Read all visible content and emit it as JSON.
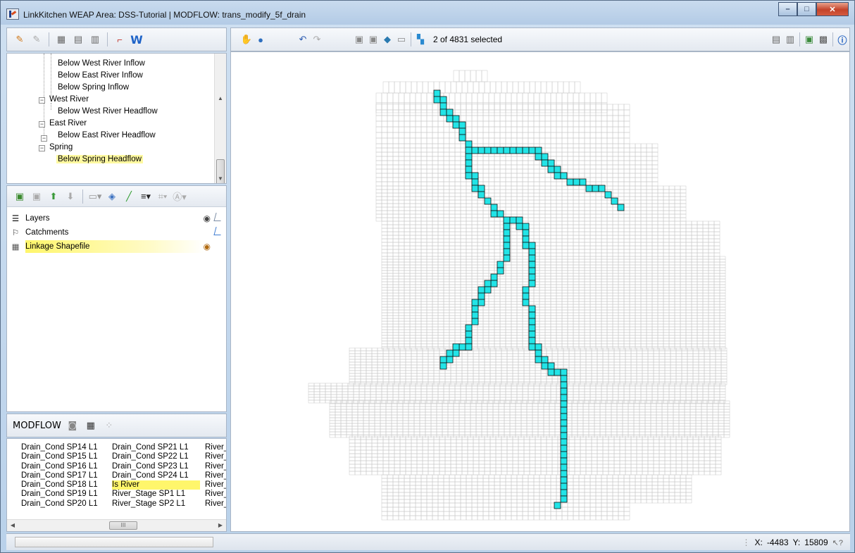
{
  "window": {
    "title": "LinkKitchen   WEAP Area: DSS-Tutorial | MODFLOW: trans_modify_5f_drain",
    "controls": {
      "minimize": "–",
      "maximize": "□",
      "close": "✕"
    }
  },
  "tree": {
    "items": [
      {
        "label": "Below West River Inflow",
        "level": 2
      },
      {
        "label": "Below East River Inflow",
        "level": 2
      },
      {
        "label": "Below Spring Inflow",
        "level": 2
      },
      {
        "label": "West River",
        "level": 1,
        "expander": "−"
      },
      {
        "label": "Below West River Headflow",
        "level": 2
      },
      {
        "label": "East River",
        "level": 1,
        "expander": "−"
      },
      {
        "label": "Below East River Headflow",
        "level": 2
      },
      {
        "label": "Spring",
        "level": 1,
        "expander": "−"
      },
      {
        "label": "Below Spring Headflow",
        "level": 2,
        "highlighted": true
      }
    ]
  },
  "layers": {
    "items": [
      {
        "label": "Layers",
        "icon": "layers-icon"
      },
      {
        "label": "Catchments",
        "icon": "catchments-icon"
      },
      {
        "label": "Linkage Shapefile",
        "icon": "grid-layer-icon",
        "highlighted": true
      }
    ]
  },
  "modflow": {
    "title": "MODFLOW",
    "columns": [
      [
        "Drain_Cond SP14 L1",
        "Drain_Cond SP15 L1",
        "Drain_Cond SP16 L1",
        "Drain_Cond SP17 L1",
        "Drain_Cond SP18 L1",
        "Drain_Cond SP19 L1",
        "Drain_Cond SP20 L1"
      ],
      [
        "Drain_Cond SP21 L1",
        "Drain_Cond SP22 L1",
        "Drain_Cond SP23 L1",
        "Drain_Cond SP24 L1",
        "Is River",
        "River_Stage SP1 L1",
        "River_Stage SP2 L1"
      ],
      [
        "River_",
        "River_",
        "River_",
        "River_",
        "River_",
        "River_",
        "River_"
      ]
    ],
    "highlighted_item": "Is River",
    "scroll_thumb": "III"
  },
  "map_toolbar": {
    "selection_text": "2 of 4831 selected"
  },
  "statusbar": {
    "x_label": "X:",
    "x_value": "-4483",
    "y_label": "Y:",
    "y_value": "15809"
  },
  "colors": {
    "river_cell": "#22e4e7",
    "grid_line": "#c8c8c8",
    "highlight": "#fff66b"
  }
}
